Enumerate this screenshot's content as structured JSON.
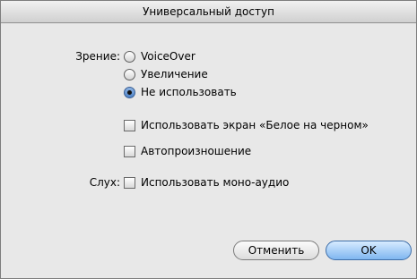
{
  "window": {
    "title": "Универсальный доступ"
  },
  "vision": {
    "label": "Зрение:",
    "options": [
      {
        "label": "VoiceOver",
        "selected": false
      },
      {
        "label": "Увеличение",
        "selected": false
      },
      {
        "label": "Не использовать",
        "selected": true
      }
    ],
    "checkboxes": [
      {
        "label": "Использовать экран «Белое на черном»",
        "checked": false
      },
      {
        "label": "Автопроизношение",
        "checked": false
      }
    ]
  },
  "hearing": {
    "label": "Слух:",
    "checkbox": {
      "label": "Использовать моно-аудио",
      "checked": false
    }
  },
  "buttons": {
    "cancel": "Отменить",
    "ok": "OK"
  }
}
